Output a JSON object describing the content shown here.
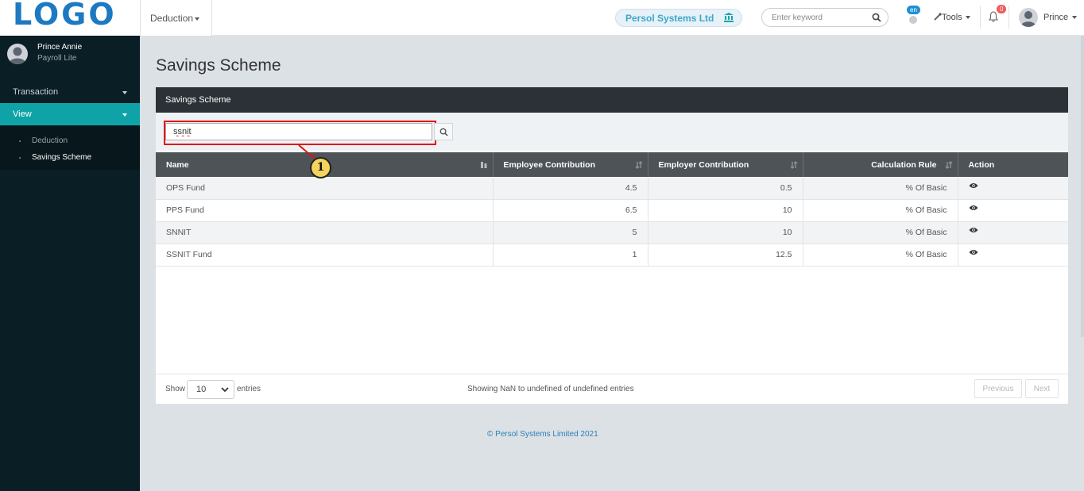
{
  "topbar": {
    "logo_text": "LOGO",
    "module_menu": "Deduction",
    "company_name": "Persol Systems Ltd",
    "search_placeholder": "Enter keyword",
    "language_badge": "en",
    "tools_label": "Tools",
    "notification_count": "0",
    "user_name": "Prince"
  },
  "sidebar": {
    "profile": {
      "name": "Prince Annie",
      "role": "Payroll Lite"
    },
    "menu": [
      {
        "label": "Transaction",
        "active": false
      },
      {
        "label": "View",
        "active": true
      }
    ],
    "submenu": [
      {
        "label": "Deduction",
        "current": false
      },
      {
        "label": "Savings Scheme",
        "current": true
      }
    ]
  },
  "page": {
    "title": "Savings Scheme",
    "panel_title": "Savings Scheme",
    "filter_value": "ssnit",
    "table": {
      "columns": [
        "Name",
        "Employee Contribution",
        "Employer Contribution",
        "Calculation Rule",
        "Action"
      ],
      "rows": [
        {
          "name": "OPS Fund",
          "employee": "4.5",
          "employer": "0.5",
          "rule": "% Of Basic"
        },
        {
          "name": "PPS Fund",
          "employee": "6.5",
          "employer": "10",
          "rule": "% Of Basic"
        },
        {
          "name": "SNNIT",
          "employee": "5",
          "employer": "10",
          "rule": "% Of Basic"
        },
        {
          "name": "SSNIT Fund",
          "employee": "1",
          "employer": "12.5",
          "rule": "% Of Basic"
        }
      ]
    },
    "pagination": {
      "show_label": "Show",
      "page_size": "10",
      "entries_label": "entries",
      "info": "Showing NaN to undefined of undefined entries",
      "previous": "Previous",
      "next": "Next"
    },
    "callout_number": "1",
    "copyright": "© Persol Systems Limited 2021"
  },
  "colors": {
    "sidebar_bg": "#0a1e25",
    "active_menu": "#0fa3a8",
    "panel_header": "#2b3136",
    "table_header": "#4e5358",
    "highlight": "#e01010",
    "callout_fill": "#f6d35e"
  },
  "icons": [
    "search-icon",
    "bank-icon",
    "globe-icon",
    "wrench-icon",
    "bell-icon",
    "eye-icon",
    "sort-icon",
    "chevron-down-icon"
  ]
}
